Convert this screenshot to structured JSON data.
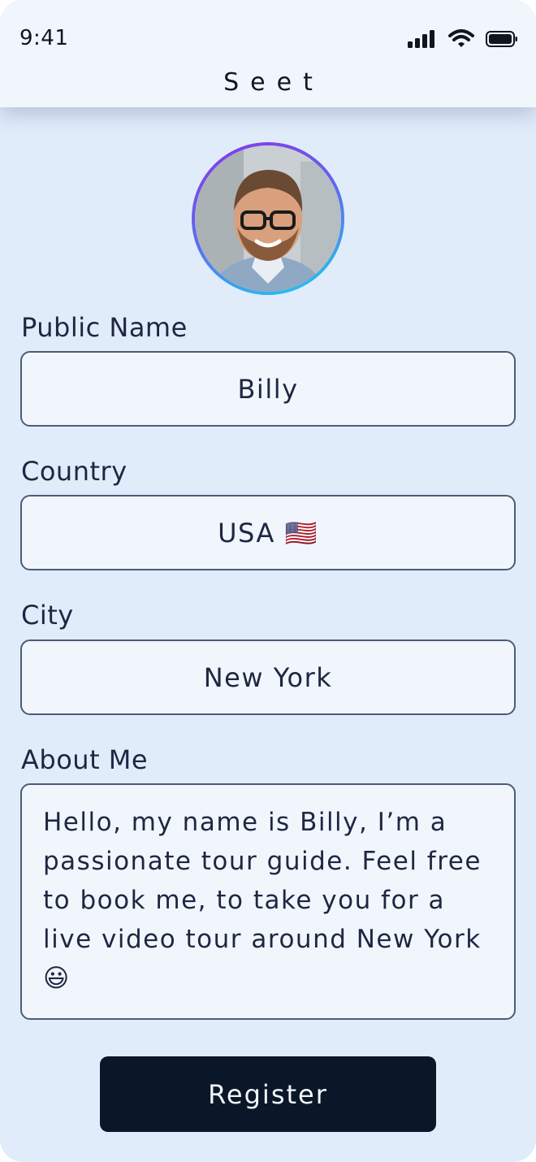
{
  "status_bar": {
    "time": "9:41"
  },
  "header": {
    "brand": "Seet"
  },
  "form": {
    "public_name": {
      "label": "Public Name",
      "value": "Billy"
    },
    "country": {
      "label": "Country",
      "value": "USA 🇺🇸"
    },
    "city": {
      "label": "City",
      "value": "New York"
    },
    "about": {
      "label": "About Me",
      "value": "Hello, my name is Billy, I’m a passionate tour guide. Feel free to book me, to take you for a live video tour around New York 😃"
    }
  },
  "actions": {
    "register_label": "Register"
  },
  "icons": {
    "signal": "cellular-signal-icon",
    "wifi": "wifi-icon",
    "battery": "battery-icon",
    "avatar": "profile-photo"
  },
  "colors": {
    "background": "#e1ecfa",
    "field": "#f1f6fc",
    "border": "#4a5c78",
    "button": "#091728"
  }
}
